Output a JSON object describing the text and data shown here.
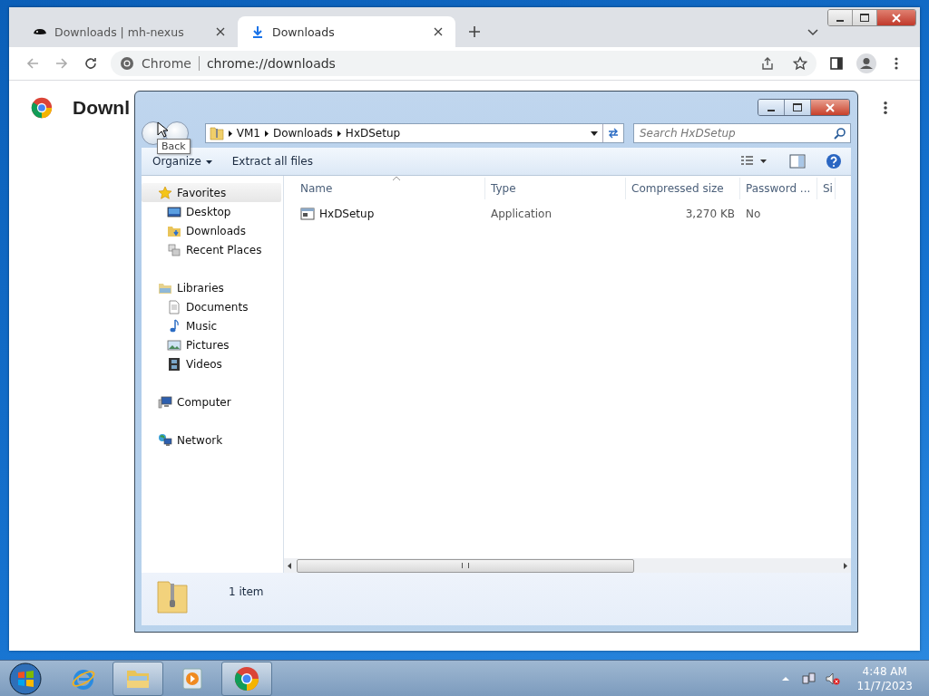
{
  "browser": {
    "tabs": [
      {
        "label": "Downloads | mh-nexus",
        "kind": "site",
        "selected": false
      },
      {
        "label": "Downloads",
        "kind": "download",
        "selected": true
      }
    ],
    "omnibox": {
      "site": "Chrome",
      "url": "chrome://downloads"
    },
    "page": {
      "heading": "Downl"
    }
  },
  "explorer": {
    "breadcrumb": [
      "VM1",
      "Downloads",
      "HxDSetup"
    ],
    "tooltip": "Back",
    "search": {
      "placeholder": "Search HxDSetup"
    },
    "commands": [
      "Organize",
      "Extract all files"
    ],
    "nav": [
      {
        "label": "Favorites",
        "kind": "star",
        "selected": true,
        "children": [
          {
            "label": "Desktop",
            "kind": "desktop"
          },
          {
            "label": "Downloads",
            "kind": "downloads"
          },
          {
            "label": "Recent Places",
            "kind": "recent"
          }
        ]
      },
      {
        "label": "Libraries",
        "kind": "libraries",
        "selected": false,
        "children": [
          {
            "label": "Documents",
            "kind": "documents"
          },
          {
            "label": "Music",
            "kind": "music"
          },
          {
            "label": "Pictures",
            "kind": "pictures"
          },
          {
            "label": "Videos",
            "kind": "videos"
          }
        ]
      },
      {
        "label": "Computer",
        "kind": "computer",
        "selected": false
      },
      {
        "label": "Network",
        "kind": "network",
        "selected": false
      }
    ],
    "columns": [
      "Name",
      "Type",
      "Compressed size",
      "Password ...",
      "Si"
    ],
    "rows": [
      {
        "cells": [
          "HxDSetup",
          "Application",
          "3,270 KB",
          "No"
        ]
      }
    ],
    "status": "1 item"
  },
  "taskbar": {
    "apps": [
      {
        "kind": "ie",
        "running": false
      },
      {
        "kind": "folder",
        "running": true
      },
      {
        "kind": "media",
        "running": false
      },
      {
        "kind": "chrome",
        "running": true
      }
    ],
    "time": "4:48 AM",
    "date": "11/7/2023"
  }
}
